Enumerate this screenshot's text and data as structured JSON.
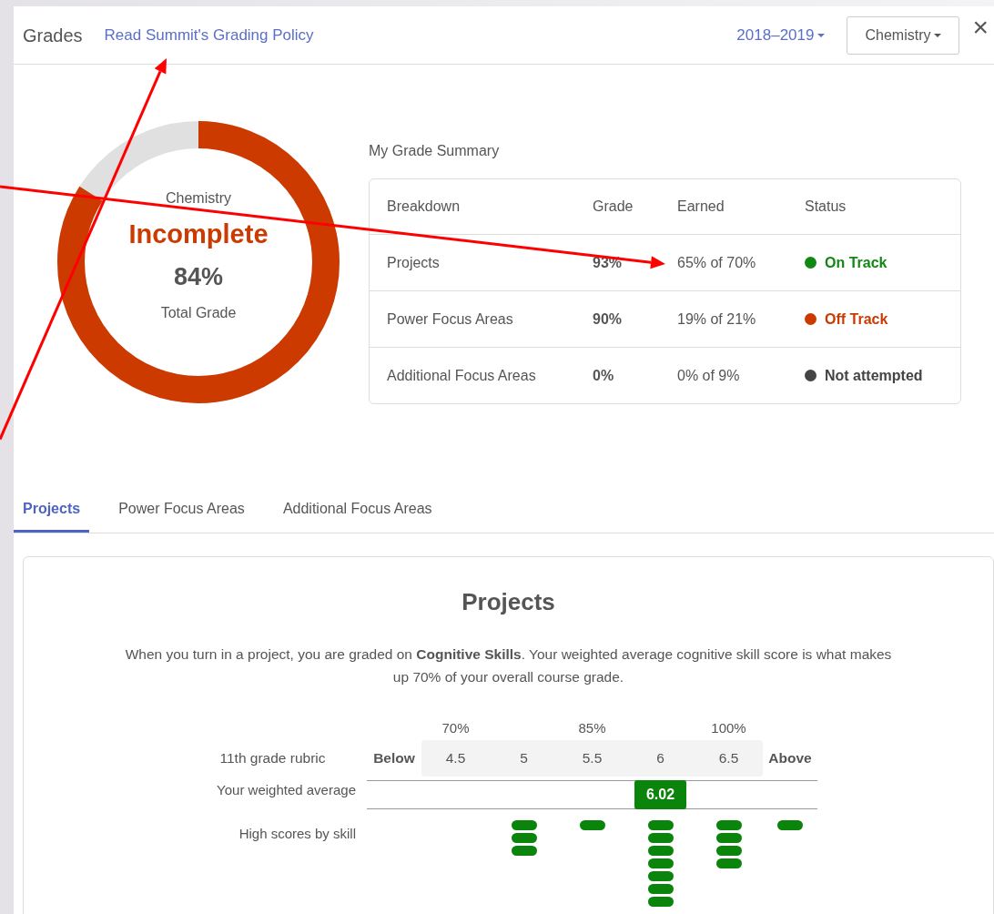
{
  "header": {
    "title": "Grades",
    "policy_link": "Read Summit's Grading Policy",
    "year_dropdown": "2018–2019",
    "course_dropdown": "Chemistry",
    "close": "×"
  },
  "grade_ring": {
    "course": "Chemistry",
    "status": "Incomplete",
    "percent": "84%",
    "caption": "Total Grade",
    "level": 0.84
  },
  "summary": {
    "title": "My Grade Summary",
    "columns": [
      "Breakdown",
      "Grade",
      "Earned",
      "Status"
    ],
    "rows": [
      {
        "breakdown": "Projects",
        "grade": "93%",
        "earned": "65% of 70%",
        "status": "On Track",
        "color": "#118811"
      },
      {
        "breakdown": "Power Focus Areas",
        "grade": "90%",
        "earned": "19% of 21%",
        "status": "Off Track",
        "color": "#cc3a00"
      },
      {
        "breakdown": "Additional Focus Areas",
        "grade": "0%",
        "earned": "0% of 9%",
        "status": "Not attempted",
        "color": "#444444"
      }
    ]
  },
  "tabs": [
    {
      "label": "Projects",
      "selected": true
    },
    {
      "label": "Power Focus Areas",
      "selected": false
    },
    {
      "label": "Additional Focus Areas",
      "selected": false
    }
  ],
  "projects_panel": {
    "title": "Projects",
    "description": "When you turn in a project, you are graded on **Cognitive Skills**. Your weighted average cognitive skill score is what makes up 70% of your overall course grade.",
    "rubric_label": "11th grade rubric",
    "average_label": "Your weighted average",
    "average_value": "6.02",
    "high_scores_label": "High scores by skill",
    "columns": [
      {
        "kind": "edge",
        "label": "Below",
        "marked": false
      },
      {
        "kind": "score",
        "label": "4.5",
        "percent": "70%",
        "marked": false
      },
      {
        "kind": "score",
        "label": "5",
        "marked": false,
        "high_scores": [
          {
            "kind": "pill"
          },
          {
            "kind": "pill"
          },
          {
            "kind": "pill"
          }
        ]
      },
      {
        "kind": "score",
        "label": "5.5",
        "percent": "85%",
        "marked": false,
        "high_scores": [
          {
            "kind": "pill"
          }
        ]
      },
      {
        "kind": "score",
        "label": "6",
        "marked": true,
        "high_scores": [
          {
            "kind": "pill"
          },
          {
            "kind": "pill"
          },
          {
            "kind": "pill"
          },
          {
            "kind": "pill"
          },
          {
            "kind": "pill"
          },
          {
            "kind": "pill"
          },
          {
            "kind": "pill"
          }
        ]
      },
      {
        "kind": "score",
        "label": "6.5",
        "percent": "100%",
        "marked": false,
        "high_scores": [
          {
            "kind": "pill"
          },
          {
            "kind": "pill"
          },
          {
            "kind": "pill"
          },
          {
            "kind": "pill"
          }
        ]
      },
      {
        "kind": "edge",
        "label": "Above",
        "marked": false,
        "high_scores": [
          {
            "kind": "pill"
          }
        ]
      }
    ]
  },
  "annotations": [
    {
      "kind": "arrow"
    },
    {
      "kind": "arrow"
    }
  ]
}
